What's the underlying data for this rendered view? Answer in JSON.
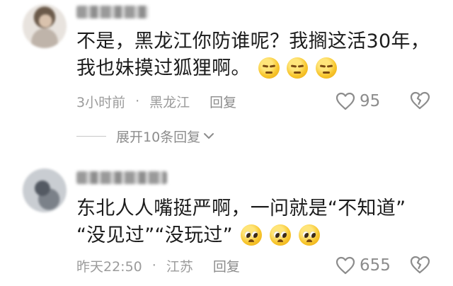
{
  "comments": [
    {
      "text_line1": "不是，黑龙江你防谁呢？我搁这活30年，",
      "text_line2": "我也妹摸过狐狸啊。",
      "emoji": [
        "unamused-face-icon",
        "unamused-face-icon",
        "unamused-face-icon"
      ],
      "time": "3小时前",
      "separator": "·",
      "location": "黑龙江",
      "reply_label": "回复",
      "likes": "95",
      "expand_label": "展开10条回复"
    },
    {
      "text_line1": "东北人人嘴挺严啊，一问就是“不知道”",
      "text_line2": "“没见过”“没玩过”",
      "emoji": [
        "pleading-face-icon",
        "pleading-face-icon",
        "pleading-face-icon"
      ],
      "time": "昨天22:50",
      "separator": "·",
      "location": "江苏",
      "reply_label": "回复",
      "likes": "655"
    }
  ],
  "colors": {
    "text": "#1c1c1c",
    "meta": "#9b9b9b",
    "icon": "#8c8c8c"
  }
}
